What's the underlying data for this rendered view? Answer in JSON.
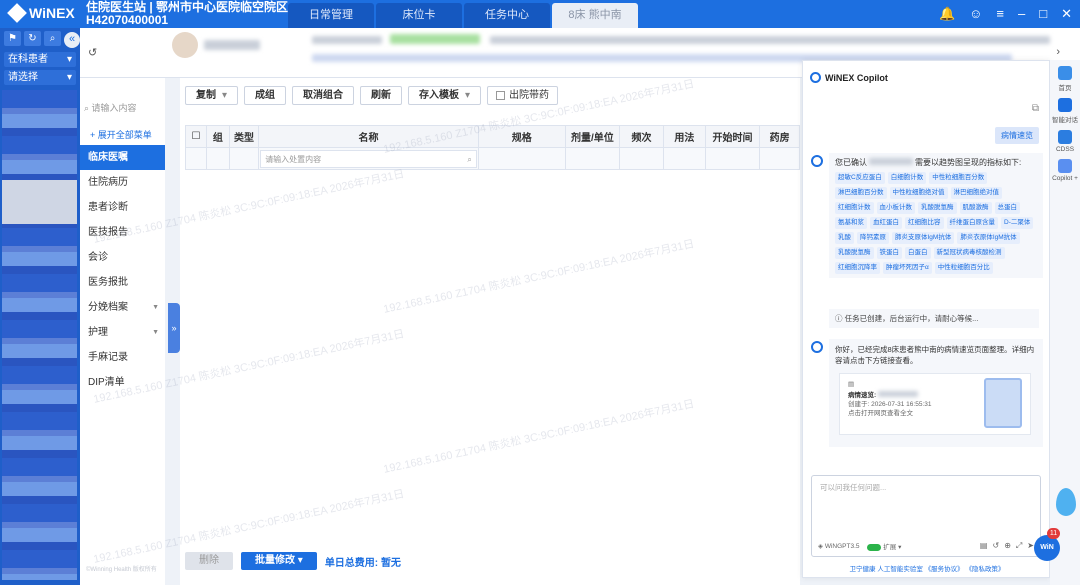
{
  "app": {
    "brand": "WiNEX",
    "station": "住院医生站 | 鄂州市中心医院临空院区",
    "staff_id": "H42070400001"
  },
  "top_tabs": [
    {
      "label": "日常管理"
    },
    {
      "label": "床位卡"
    },
    {
      "label": "任务中心"
    },
    {
      "label": "8床 熊中南"
    }
  ],
  "left_panel": {
    "patient_filter": "在科患者",
    "select_placeholder": "请选择"
  },
  "menu": {
    "search_placeholder": "请输入内容",
    "expand_label": "展开全部菜单",
    "items": [
      {
        "label": "临床医嘱"
      },
      {
        "label": "住院病历"
      },
      {
        "label": "患者诊断"
      },
      {
        "label": "医技报告"
      },
      {
        "label": "会诊"
      },
      {
        "label": "医务报批"
      },
      {
        "label": "分娩档案"
      },
      {
        "label": "护理"
      },
      {
        "label": "手麻记录"
      },
      {
        "label": "DIP清单"
      }
    ],
    "copyright": "©Winning Health 版权所有"
  },
  "toolbar": {
    "copy": "复制",
    "group": "成组",
    "ungroup": "取消组合",
    "refresh": "刷新",
    "save_template": "存入模板",
    "discharge_meds": "出院带药"
  },
  "grid": {
    "headers": [
      "组",
      "类型",
      "名称",
      "规格",
      "剂量/单位",
      "频次",
      "用法",
      "开始时间",
      "药房"
    ],
    "name_filter_placeholder": "请输入处置内容"
  },
  "footer": {
    "delete": "删除",
    "batch_edit": "批量修改",
    "fee_label": "单日总费用:",
    "fee_value": "暂无"
  },
  "watermark": {
    "text": "192.168.5.160 Z1704 陈炎松 3C:9C:0F:09:18:EA 2026年7月31日"
  },
  "copilot": {
    "title": "WiNEX Copilot",
    "user_msg": "病情速览",
    "bot_intro": "您已确认",
    "bot_intro_tail": "需要以趋势图呈现的指标如下:",
    "indicators": [
      "超敏C反应蛋白",
      "白细胞计数",
      "中性粒细胞百分数",
      "淋巴细胞百分数",
      "中性粒细胞绝对值",
      "淋巴细胞绝对值",
      "红细胞计数",
      "血小板计数",
      "乳酸脱氢酶",
      "肌酸激酶",
      "总蛋白",
      "氨基和浆",
      "血红蛋白",
      "红细胞比容",
      "纤维蛋白原含量",
      "D-二聚体",
      "乳酸",
      "降钙素原",
      "肺炎支原体IgM抗体",
      "肺炎衣原体IgM抗体",
      "乳酸脱氢酶",
      "铁蛋白",
      "白蛋白",
      "新型冠状病毒核酸检测",
      "红细胞沉降率",
      "肿瘤坏死因子α",
      "中性粒细胞百分比"
    ],
    "task_note": "任务已创建，后台运行中，请耐心等候...",
    "done_msg": "你好，已经完成8床患者熊中南的病情速览页面整理。详细内容请点击下方链接查看。",
    "card_title": "病情速览:",
    "card_created": "创建于: 2026-07-31 16:55:31",
    "card_hint": "点击打开网页查看全文",
    "input_placeholder": "可以问我任何问题...",
    "model": "WiNGPT3.5",
    "expand_toggle": "扩展",
    "footer": "卫宁健康 人工智能实验室 《服务协议》 《隐私政策》"
  },
  "right_rail": [
    {
      "label": "首页"
    },
    {
      "label": "智能对话"
    },
    {
      "label": "CDSS"
    },
    {
      "label": "Copilot +"
    }
  ],
  "assistant_badge": {
    "label": "WiN",
    "count": "11"
  }
}
